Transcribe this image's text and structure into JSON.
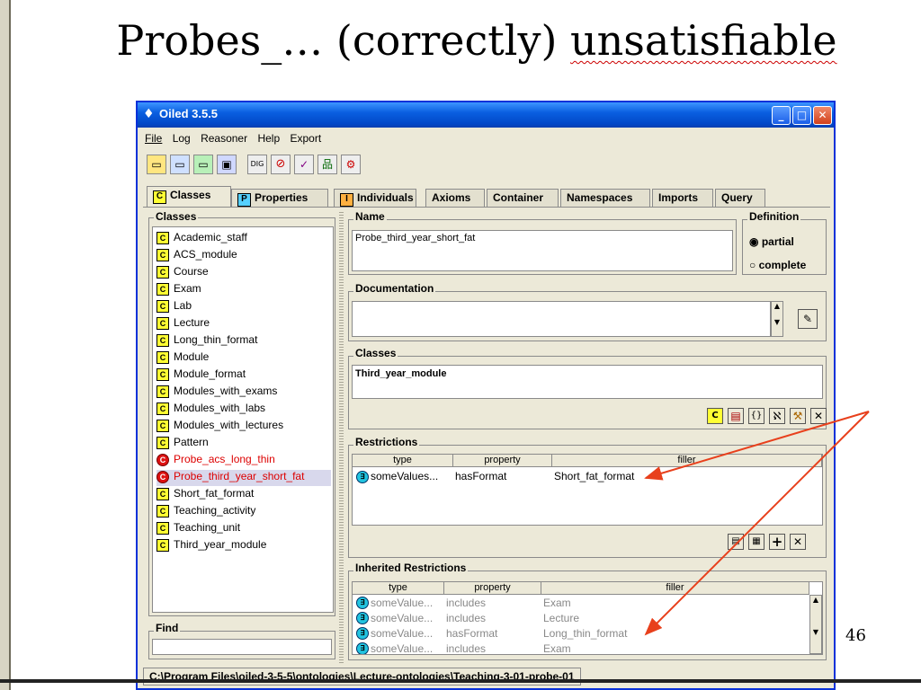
{
  "slide": {
    "title_plain": "Probes_… (correctly) ",
    "title_underlined": "unsatisfiable",
    "page_number": "46"
  },
  "window": {
    "title": "Oiled 3.5.5",
    "menu": [
      "File",
      "Log",
      "Reasoner",
      "Help",
      "Export"
    ],
    "tabs": [
      {
        "badge": "C",
        "label": "Classes"
      },
      {
        "badge": "P",
        "label": "Properties"
      },
      {
        "badge": "I",
        "label": "Individuals"
      },
      {
        "badge": "",
        "label": "Axioms"
      },
      {
        "badge": "",
        "label": "Container"
      },
      {
        "badge": "",
        "label": "Namespaces"
      },
      {
        "badge": "",
        "label": "Imports"
      },
      {
        "badge": "",
        "label": "Query"
      }
    ],
    "classes_panel": {
      "label": "Classes",
      "items": [
        {
          "label": "Academic_staff",
          "state": "normal"
        },
        {
          "label": "ACS_module",
          "state": "normal"
        },
        {
          "label": "Course",
          "state": "normal"
        },
        {
          "label": "Exam",
          "state": "normal"
        },
        {
          "label": "Lab",
          "state": "normal"
        },
        {
          "label": "Lecture",
          "state": "normal"
        },
        {
          "label": "Long_thin_format",
          "state": "normal"
        },
        {
          "label": "Module",
          "state": "normal"
        },
        {
          "label": "Module_format",
          "state": "normal"
        },
        {
          "label": "Modules_with_exams",
          "state": "normal"
        },
        {
          "label": "Modules_with_labs",
          "state": "normal"
        },
        {
          "label": "Modules_with_lectures",
          "state": "normal"
        },
        {
          "label": "Pattern",
          "state": "normal"
        },
        {
          "label": "Probe_acs_long_thin",
          "state": "unsatisfiable"
        },
        {
          "label": "Probe_third_year_short_fat",
          "state": "unsatisfiable-selected"
        },
        {
          "label": "Short_fat_format",
          "state": "normal"
        },
        {
          "label": "Teaching_activity",
          "state": "normal"
        },
        {
          "label": "Teaching_unit",
          "state": "normal"
        },
        {
          "label": "Third_year_module",
          "state": "normal"
        }
      ],
      "find_label": "Find",
      "find_value": ""
    },
    "name_group": {
      "label": "Name",
      "value": "Probe_third_year_short_fat"
    },
    "definition_group": {
      "label": "Definition",
      "options": [
        "partial",
        "complete"
      ],
      "selected": "partial"
    },
    "documentation_group": {
      "label": "Documentation",
      "value": ""
    },
    "superclasses_group": {
      "label": "Classes",
      "value": "Third_year_module"
    },
    "restrictions_group": {
      "label": "Restrictions",
      "columns": [
        "type",
        "property",
        "filler"
      ],
      "rows": [
        {
          "icon": "∃",
          "type": "someValues...",
          "property": "hasFormat",
          "filler": "Short_fat_format"
        }
      ]
    },
    "inherited_group": {
      "label": "Inherited Restrictions",
      "columns": [
        "type",
        "property",
        "filler"
      ],
      "rows": [
        {
          "icon": "∃",
          "type": "someValue...",
          "property": "includes",
          "filler": "Exam"
        },
        {
          "icon": "∃",
          "type": "someValue...",
          "property": "includes",
          "filler": "Lecture"
        },
        {
          "icon": "∃",
          "type": "someValue...",
          "property": "hasFormat",
          "filler": "Long_thin_format"
        },
        {
          "icon": "∃",
          "type": "someValue...",
          "property": "includes",
          "filler": "Exam"
        }
      ]
    },
    "status_path": "C:\\Program Files\\oiled-3-5-5\\ontologies\\Lecture-ontologies\\Teaching-3-01-probe-01"
  },
  "colors": {
    "titlebar": "#0a5fe0",
    "unsatisfiable": "#dd0000",
    "annotation_arrow": "#e8401c",
    "class_badge": "#ffff33"
  }
}
